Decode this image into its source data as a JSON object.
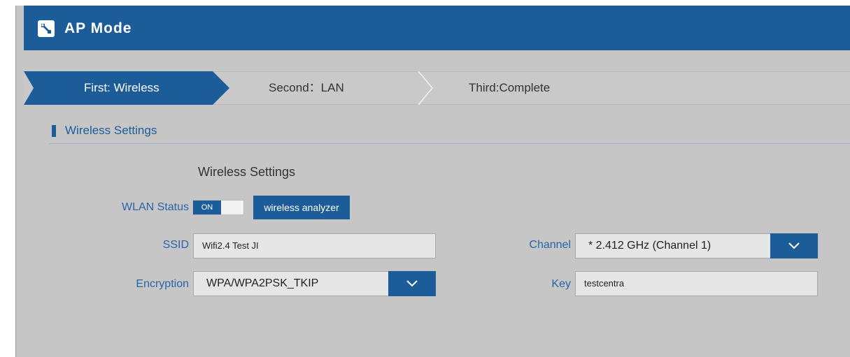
{
  "header": {
    "title": "AP Mode",
    "icon": "wrench-icon"
  },
  "steps": [
    {
      "label": "First: Wireless",
      "active": true
    },
    {
      "label": "Second：LAN",
      "active": false
    },
    {
      "label": "Third:Complete",
      "active": false
    }
  ],
  "section": {
    "title": "Wireless Settings"
  },
  "form": {
    "title": "Wireless Settings",
    "wlan_status_label": "WLAN Status",
    "toggle_label": "ON",
    "analyzer_label": "wireless analyzer",
    "ssid_label": "SSID",
    "ssid_value": "Wifi2.4 Test JI",
    "encryption_label": "Encryption",
    "encryption_value": "WPA/WPA2PSK_TKIP",
    "channel_label": "Channel",
    "channel_value": "* 2.412 GHz (Channel 1)",
    "key_label": "Key",
    "key_value": "testcentra"
  },
  "colors": {
    "accent": "#1b5c99",
    "label": "#2a64a8",
    "background": "#c6c6c6"
  }
}
